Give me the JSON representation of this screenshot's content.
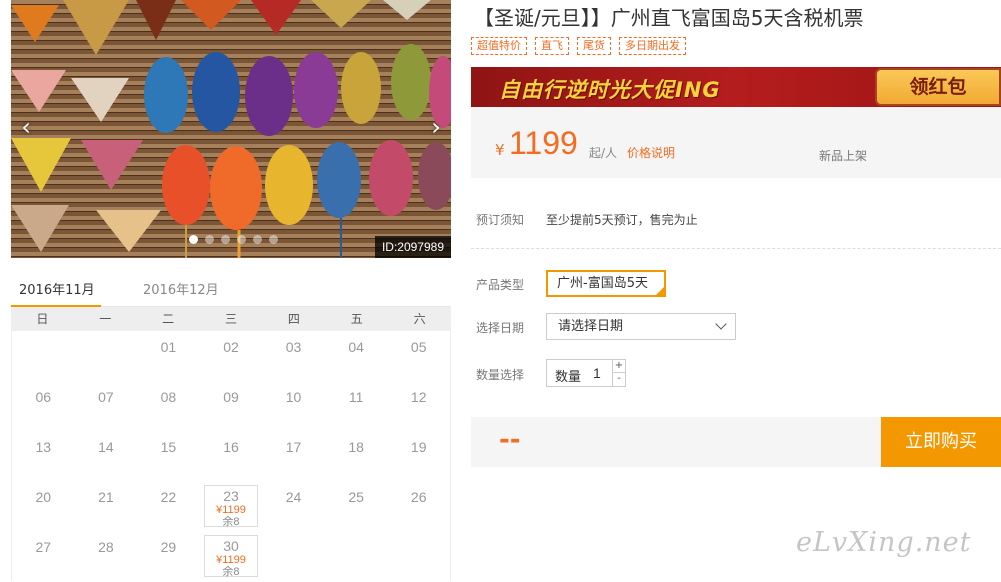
{
  "gallery": {
    "image_id": "ID:2097989",
    "prev_arrow": "‹",
    "next_arrow": "›",
    "dots": 6,
    "active_dot": 0
  },
  "calendar": {
    "tabs": [
      {
        "label": "2016年11月",
        "active": true
      },
      {
        "label": "2016年12月",
        "active": false
      }
    ],
    "weekdays": [
      "日",
      "一",
      "二",
      "三",
      "四",
      "五",
      "六"
    ],
    "leading_blanks": 2,
    "days": [
      {
        "day": "01"
      },
      {
        "day": "02"
      },
      {
        "day": "03"
      },
      {
        "day": "04"
      },
      {
        "day": "05"
      },
      {
        "day": "06"
      },
      {
        "day": "07"
      },
      {
        "day": "08"
      },
      {
        "day": "09"
      },
      {
        "day": "10"
      },
      {
        "day": "11"
      },
      {
        "day": "12"
      },
      {
        "day": "13"
      },
      {
        "day": "14"
      },
      {
        "day": "15"
      },
      {
        "day": "16"
      },
      {
        "day": "17"
      },
      {
        "day": "18"
      },
      {
        "day": "19"
      },
      {
        "day": "20"
      },
      {
        "day": "21"
      },
      {
        "day": "22"
      },
      {
        "day": "23",
        "price": "¥1199",
        "remain": "余8"
      },
      {
        "day": "24"
      },
      {
        "day": "25"
      },
      {
        "day": "26"
      },
      {
        "day": "27"
      },
      {
        "day": "28"
      },
      {
        "day": "29"
      },
      {
        "day": "30",
        "price": "¥1199",
        "remain": "余8"
      }
    ]
  },
  "product": {
    "title": "【圣诞/元旦】】广州直飞富国岛5天含税机票",
    "tags": [
      "超值特价",
      "直飞",
      "尾货",
      "多日期出发"
    ]
  },
  "banner": {
    "text": "自由行逆时光大促ING",
    "button": "领红包"
  },
  "price": {
    "currency": "¥",
    "amount": "1199",
    "unit": "起/人",
    "explain_link": "价格说明",
    "new_label": "新品上架"
  },
  "booking": {
    "notice_label": "预订须知",
    "notice_value": "至少提前5天预订，售完为止",
    "type_label": "产品类型",
    "type_option": "广州-富国岛5天",
    "date_label": "选择日期",
    "date_placeholder": "请选择日期",
    "qty_label": "数量选择",
    "qty_text": "数量",
    "qty_value": "1",
    "qty_plus": "+",
    "qty_minus": "-",
    "total": "--",
    "buy_button": "立即购买"
  },
  "watermark": "eLvXing.net",
  "colors": {
    "accent": "#f39800",
    "price": "#f36c21",
    "banner": "#a81818"
  }
}
